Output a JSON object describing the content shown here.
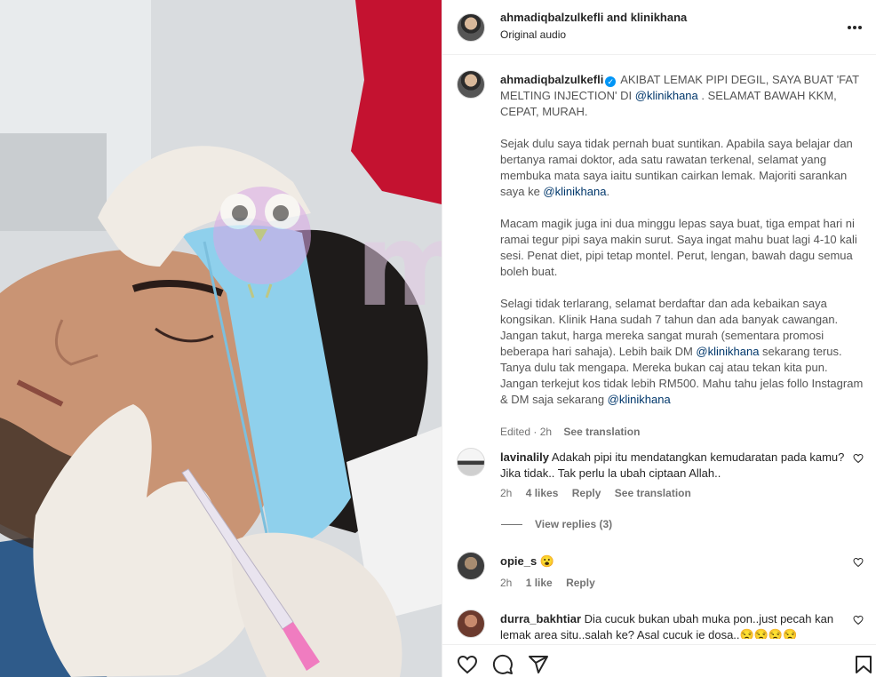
{
  "media": {
    "watermark_text": "murai",
    "colors": {
      "headband": "#8fd0ec",
      "glove": "#f0ebe4",
      "skin": "#c99474",
      "scrub": "#c41230"
    }
  },
  "header": {
    "username_1": "ahmadiqbalzulkefli",
    "and_text": "and",
    "username_2": "klinikhana",
    "audio": "Original audio",
    "more_icon": "more-horizontal-icon"
  },
  "caption": {
    "username": "ahmadiqbalzulkefli",
    "lines_1": "AKIBAT LEMAK PIPI DEGIL, SAYA BUAT 'FAT MELTING INJECTION' DI ",
    "mention_1": "@klinikhana",
    "lines_1b": " . SELAMAT BAWAH KKM, CEPAT, MURAH.",
    "para_2a": "Sejak dulu saya tidak pernah buat suntikan. Apabila saya belajar dan bertanya ramai doktor, ada satu rawatan terkenal, selamat yang membuka mata saya iaitu suntikan cairkan lemak. Majoriti sarankan saya ke ",
    "mention_2": "@klinikhana",
    "para_2b": ".",
    "para_3": "Macam magik juga ini dua minggu lepas saya buat, tiga empat hari ni ramai tegur pipi saya makin surut. Saya ingat mahu buat lagi 4-10 kali sesi. Penat diet, pipi tetap montel. Perut, lengan, bawah dagu semua boleh buat.",
    "para_4a": "Selagi tidak terlarang, selamat berdaftar dan ada kebaikan saya kongsikan. Klinik Hana sudah 7 tahun dan ada banyak cawangan. Jangan takut, harga mereka sangat murah (sementara promosi beberapa hari sahaja). Lebih baik DM ",
    "mention_3": "@klinikhana",
    "para_4b": " sekarang terus. Tanya dulu tak mengapa. Mereka bukan caj atau tekan kita pun. Jangan terkejut kos tidak lebih RM500. Mahu tahu jelas follo Instagram & DM saja sekarang ",
    "mention_4": "@klinikhana",
    "edited": "Edited · 2h",
    "see_translation": "See translation"
  },
  "comments": [
    {
      "username": "lavinalily",
      "text": "Adakah pipi itu mendatangkan kemudaratan pada kamu? Jika tidak.. Tak perlu la ubah ciptaan Allah..",
      "time": "2h",
      "likes": "4 likes",
      "reply": "Reply",
      "see_translation": "See translation",
      "view_replies": "View replies (3)"
    },
    {
      "username": "opie_s",
      "text": "😮",
      "time": "2h",
      "likes": "1 like",
      "reply": "Reply"
    },
    {
      "username": "durra_bakhtiar",
      "text": "Dia cucuk bukan ubah muka pon..just pecah kan lemak area situ..salah ke? Asal cucuk je dosa..😒😒😒😒"
    }
  ],
  "actions": {
    "like_icon": "heart-icon",
    "comment_icon": "comment-icon",
    "share_icon": "share-icon",
    "save_icon": "bookmark-icon"
  }
}
